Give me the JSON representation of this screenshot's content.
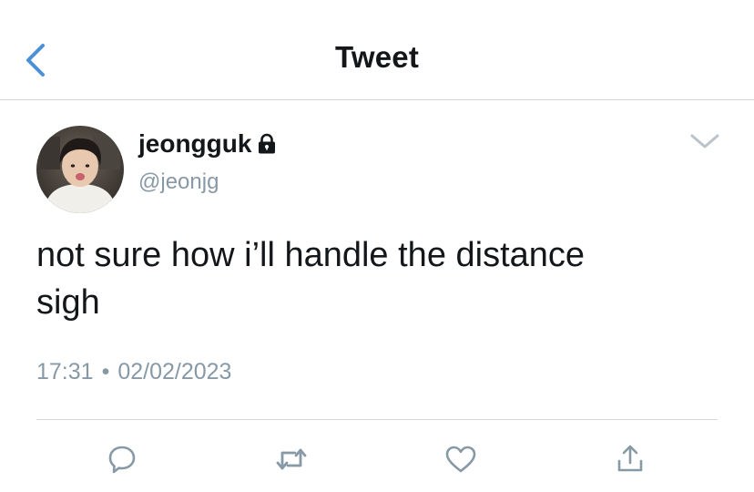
{
  "header": {
    "title": "Tweet",
    "back_icon": "chevron-left-icon"
  },
  "author": {
    "display_name": "jeongguk",
    "handle": "@jeonjg",
    "protected": true,
    "lock_icon": "lock-icon",
    "avatar": "avatar-photo"
  },
  "tweet": {
    "lines": [
      "not sure how i’ll handle the distance",
      "sigh"
    ],
    "time": "17:31",
    "separator": "•",
    "date": "02/02/2023"
  },
  "actions": [
    {
      "name": "reply",
      "icon": "reply-bubble-icon"
    },
    {
      "name": "retweet",
      "icon": "retweet-icon"
    },
    {
      "name": "like",
      "icon": "heart-icon"
    },
    {
      "name": "share",
      "icon": "share-icon"
    }
  ],
  "colors": {
    "accent": "#4a90d9",
    "text": "#14171a",
    "secondary": "#8899a6",
    "divider": "#d5d8dc"
  }
}
